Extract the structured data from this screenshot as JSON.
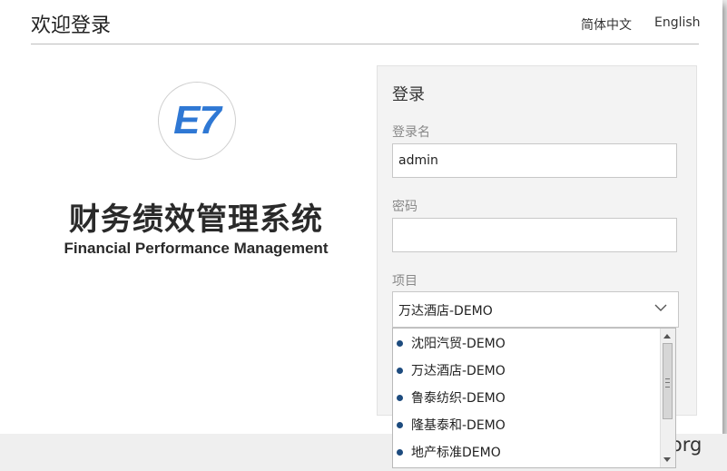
{
  "header": {
    "title": "欢迎登录",
    "lang_cn": "简体中文",
    "lang_en": "English"
  },
  "brand": {
    "logo_text": "E7",
    "system_title": "财务绩效管理系统",
    "system_subtitle": "Financial Performance Management",
    "logo_color": "#2f78d4"
  },
  "login": {
    "title": "登录",
    "username_label": "登录名",
    "username_value": "admin",
    "password_label": "密码",
    "password_value": "",
    "project_label": "项目",
    "project_selected": "万达酒店-DEMO",
    "project_options": [
      "沈阳汽贸-DEMO",
      "万达酒店-DEMO",
      "鲁泰纺织-DEMO",
      "隆基泰和-DEMO",
      "地产标准DEMO"
    ]
  },
  "watermark": "www.wooyun.org"
}
